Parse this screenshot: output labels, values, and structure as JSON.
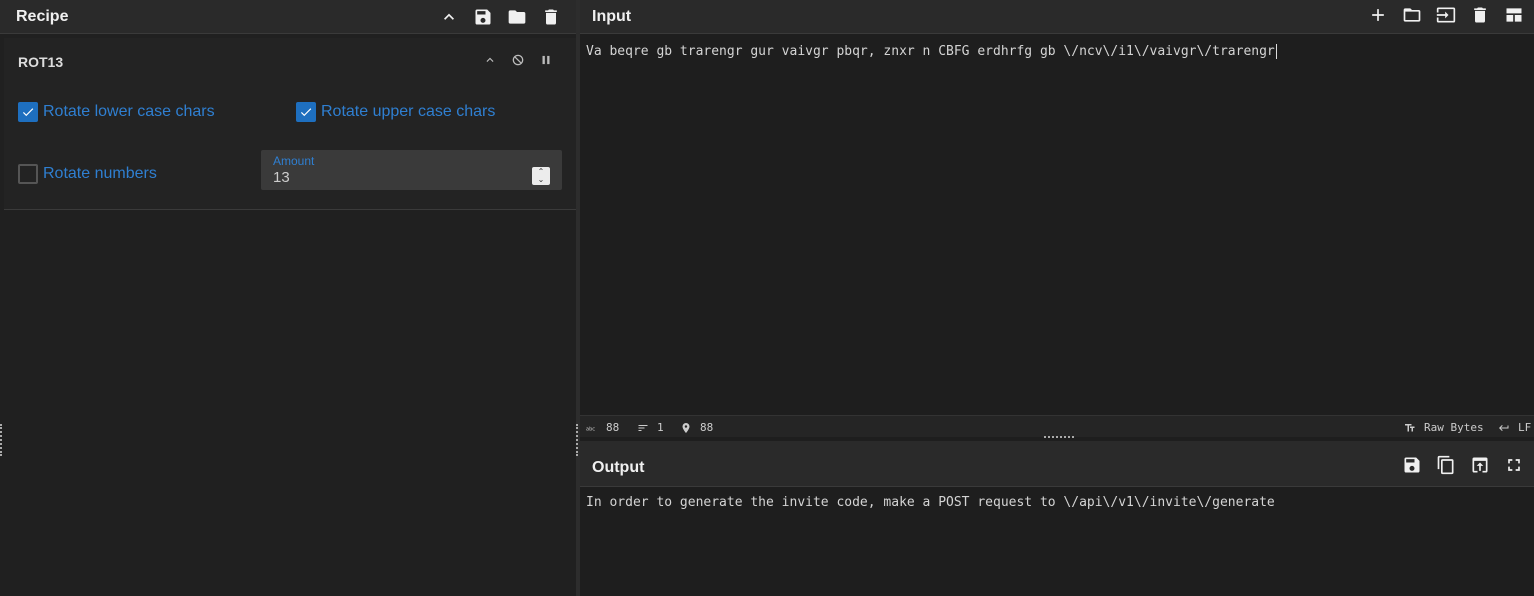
{
  "recipe": {
    "title": "Recipe",
    "operation": {
      "name": "ROT13",
      "options": {
        "rotate_lower": {
          "label": "Rotate lower case chars",
          "checked": true
        },
        "rotate_upper": {
          "label": "Rotate upper case chars",
          "checked": true
        },
        "rotate_numbers": {
          "label": "Rotate numbers",
          "checked": false
        },
        "amount": {
          "label": "Amount",
          "value": "13"
        }
      }
    },
    "header_icons": [
      "chevron-up-icon",
      "save-icon",
      "folder-icon",
      "trash-icon"
    ]
  },
  "input": {
    "title": "Input",
    "text": "Va beqre gb trarengr gur vaivgr pbqr, znxr n CBFG erdhrfg gb \\/ncv\\/i1\\/vaivgr\\/trarengr",
    "header_icons": [
      "plus-icon",
      "folder-icon",
      "import-icon",
      "trash-icon",
      "layout-icon"
    ],
    "status": {
      "length": "88",
      "lines": "1",
      "position": "88",
      "encoding": "Raw Bytes",
      "eol": "LF"
    }
  },
  "output": {
    "title": "Output",
    "text": "In order to generate the invite code, make a POST request to \\/api\\/v1\\/invite\\/generate",
    "header_icons": [
      "save-icon",
      "copy-icon",
      "replace-input-icon",
      "maximize-icon"
    ]
  },
  "colors": {
    "accent": "#2f7fd1",
    "checkbox_on": "#1e6fbf",
    "background": "#1e1e1e",
    "header": "#2a2a2a"
  }
}
